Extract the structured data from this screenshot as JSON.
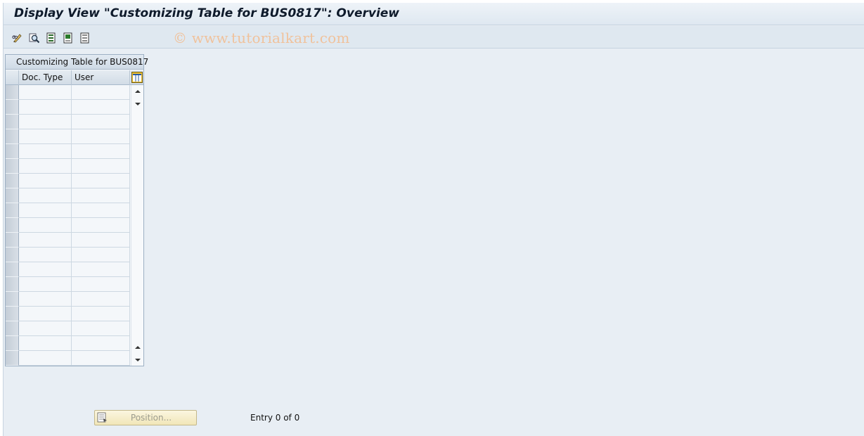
{
  "window": {
    "title": "Display View \"Customizing Table for BUS0817\": Overview"
  },
  "toolbar": {
    "icons": [
      "display-change-icon",
      "find-icon",
      "select-all-icon",
      "select-block-icon",
      "deselect-all-icon"
    ],
    "watermark": "© www.tutorialkart.com"
  },
  "table": {
    "title": "Customizing Table for BUS0817",
    "columns": [
      "Doc. Type",
      "User"
    ],
    "rows": [
      [
        "",
        ""
      ],
      [
        "",
        ""
      ],
      [
        "",
        ""
      ],
      [
        "",
        ""
      ],
      [
        "",
        ""
      ],
      [
        "",
        ""
      ],
      [
        "",
        ""
      ],
      [
        "",
        ""
      ],
      [
        "",
        ""
      ],
      [
        "",
        ""
      ],
      [
        "",
        ""
      ],
      [
        "",
        ""
      ],
      [
        "",
        ""
      ],
      [
        "",
        ""
      ],
      [
        "",
        ""
      ],
      [
        "",
        ""
      ],
      [
        "",
        ""
      ],
      [
        "",
        ""
      ],
      [
        "",
        ""
      ]
    ]
  },
  "footer": {
    "position_label": "Position...",
    "entry_text": "Entry 0 of 0"
  },
  "colors": {
    "background": "#e8eef4",
    "watermark": "#f0c29c",
    "button_bg": "#f1e6b8"
  }
}
